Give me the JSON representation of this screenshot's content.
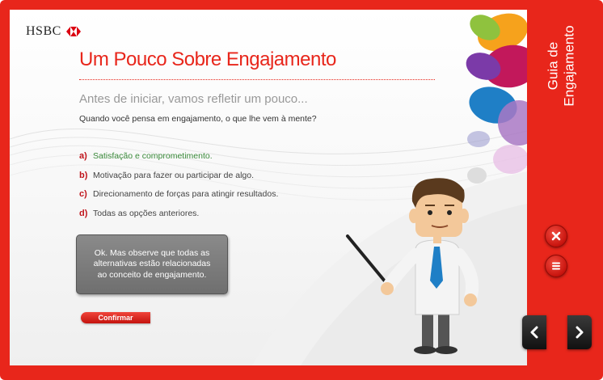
{
  "header": {
    "logo_text": "HSBC",
    "title": "Um Pouco Sobre Engajamento",
    "subtitle": "Antes de iniciar, vamos refletir um pouco...",
    "question": "Quando você pensa em engajamento, o que lhe vem à mente?"
  },
  "options": [
    {
      "letter": "a)",
      "text": "Satisfação e comprometimento.",
      "selected": true
    },
    {
      "letter": "b)",
      "text": "Motivação para fazer ou participar de algo.",
      "selected": false
    },
    {
      "letter": "c)",
      "text": "Direcionamento de forças para atingir resultados.",
      "selected": false
    },
    {
      "letter": "d)",
      "text": "Todas as opções anteriores.",
      "selected": false
    }
  ],
  "feedback": {
    "text": "Ok. Mas observe que todas as alternativas estão relacionadas ao conceito de engajamento."
  },
  "confirm_label": "Confirmar",
  "side_panel": {
    "title_line1": "Guia de",
    "title_line2": "Engajamento",
    "close_icon": "close-icon",
    "menu_icon": "menu-icon",
    "prev_icon": "chevron-left-icon",
    "next_icon": "chevron-right-icon"
  },
  "colors": {
    "brand_red": "#e8261b",
    "selected_green": "#3a8a3a",
    "feedback_gray": "#7a7a7a"
  }
}
